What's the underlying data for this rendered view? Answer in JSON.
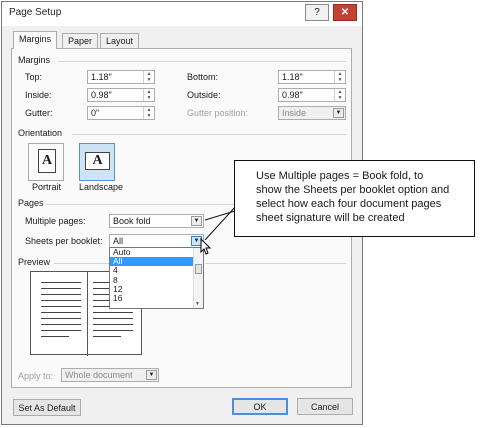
{
  "window": {
    "title": "Page Setup",
    "help_glyph": "?",
    "close_glyph": "✕"
  },
  "tabs": [
    {
      "label": "Margins",
      "active": true
    },
    {
      "label": "Paper",
      "active": false
    },
    {
      "label": "Layout",
      "active": false
    }
  ],
  "margins": {
    "section_label": "Margins",
    "top": {
      "label": "Top:",
      "value": "1.18\""
    },
    "bottom": {
      "label": "Bottom:",
      "value": "1.18\""
    },
    "inside": {
      "label": "Inside:",
      "value": "0.98\""
    },
    "outside": {
      "label": "Outside:",
      "value": "0.98\""
    },
    "gutter": {
      "label": "Gutter:",
      "value": "0\""
    },
    "gutter_position": {
      "label": "Gutter position:",
      "value": "Inside"
    }
  },
  "orientation": {
    "section_label": "Orientation",
    "portrait": {
      "label": "Portrait",
      "glyph": "A",
      "selected": false
    },
    "landscape": {
      "label": "Landscape",
      "glyph": "A",
      "selected": true
    }
  },
  "pages": {
    "section_label": "Pages",
    "multiple_pages": {
      "label": "Multiple pages:",
      "value": "Book fold"
    },
    "sheets_per_booklet": {
      "label": "Sheets per booklet:",
      "value": "All",
      "options": [
        "Auto",
        "All",
        "4",
        "8",
        "12",
        "16"
      ],
      "highlighted": "All"
    }
  },
  "preview": {
    "section_label": "Preview"
  },
  "apply_to": {
    "label": "Apply to:",
    "value": "Whole document"
  },
  "buttons": {
    "set_default": "Set As Default",
    "ok": "OK",
    "cancel": "Cancel"
  },
  "callout": {
    "lines": [
      "Use Multiple pages = Book fold, to",
      "show the Sheets per booklet option and",
      "select how each four document pages",
      "sheet signature will be created"
    ]
  },
  "icons": {
    "spin_up": "▲",
    "spin_down": "▼",
    "dropdown_arrow": "▼"
  },
  "colors": {
    "close_button": "#c44233",
    "selection": "#3399ff",
    "landscape_selected": "#cfe3f7"
  }
}
